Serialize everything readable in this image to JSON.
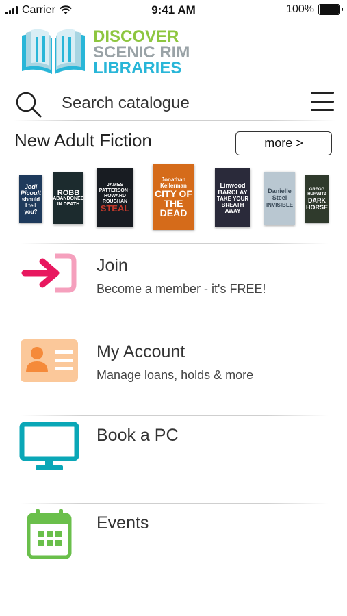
{
  "status_bar": {
    "carrier": "Carrier",
    "time": "9:41 AM",
    "battery": "100%"
  },
  "logo": {
    "line1": "DISCOVER",
    "line2": "SCENIC RIM",
    "line3": "LIBRARIES"
  },
  "search": {
    "placeholder": "Search catalogue"
  },
  "section": {
    "title": "New Adult Fiction",
    "more_label": "more >"
  },
  "covers": [
    {
      "title": "should I tell you?",
      "author": "Jodi Picoult",
      "bg": "#1e3a5c"
    },
    {
      "title": "ABANDONED IN DEATH",
      "author": "ROBB",
      "bg": "#1c2b2e"
    },
    {
      "title": "STEAL",
      "author": "JAMES PATTERSON · HOWARD ROUGHAN",
      "bg": "#181c22"
    },
    {
      "title": "CITY OF THE DEAD",
      "author": "Jonathan Kellerman",
      "bg": "#d56b1a"
    },
    {
      "title": "TAKE YOUR BREATH AWAY",
      "author": "Linwood BARCLAY",
      "bg": "#2a2a3a"
    },
    {
      "title": "INVISIBLE",
      "author": "Danielle Steel",
      "bg": "#b9c7d1"
    },
    {
      "title": "DARK HORSE",
      "author": "GREGG HURWITZ",
      "bg": "#2f3a2c"
    }
  ],
  "menu": [
    {
      "title": "Join",
      "subtitle": "Become a member - it's FREE!",
      "icon": "join-icon"
    },
    {
      "title": "My Account",
      "subtitle": "Manage loans, holds & more",
      "icon": "account-card-icon"
    },
    {
      "title": "Book a PC",
      "subtitle": "",
      "icon": "monitor-icon"
    },
    {
      "title": "Events",
      "subtitle": "",
      "icon": "calendar-icon"
    }
  ],
  "colors": {
    "join_pink": "#e8185f",
    "join_light_pink": "#f5a0bd",
    "account_orange": "#f59d4f",
    "account_bg": "#fbc89a",
    "pc_teal": "#0aa7b7",
    "events_green": "#6abf4b"
  }
}
